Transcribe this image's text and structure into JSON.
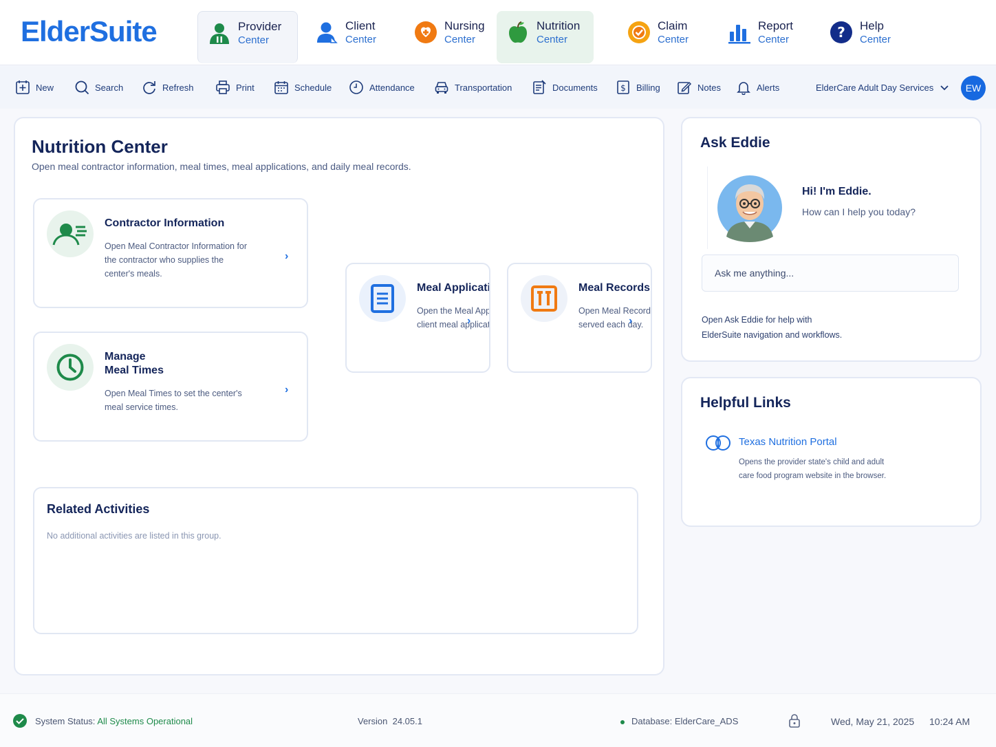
{
  "app": {
    "logo": "ElderSuite"
  },
  "centers": [
    {
      "l1": "Provider",
      "l2": "Center",
      "icon": "provider-icon"
    },
    {
      "l1": "Client",
      "l2": "Center",
      "icon": "client-icon"
    },
    {
      "l1": "Nursing",
      "l2": "Center",
      "icon": "nursing-icon"
    },
    {
      "l1": "Nutrition",
      "l2": "Center",
      "icon": "apple-icon"
    },
    {
      "l1": "Claim",
      "l2": "Center",
      "icon": "claim-icon"
    },
    {
      "l1": "Report",
      "l2": "Center",
      "icon": "bar-chart-icon"
    },
    {
      "l1": "Help",
      "l2": "Center",
      "icon": "help-icon"
    }
  ],
  "toolbar": {
    "items": [
      "New",
      "Search",
      "Refresh",
      "Print",
      "Schedule",
      "Attendance",
      "Transportation",
      "Documents",
      "Billing",
      "Notes",
      "Alerts"
    ],
    "org": "ElderCare Adult Day Services",
    "user_initials": "EW"
  },
  "main": {
    "title": "Nutrition Center",
    "subtitle": "Open meal contractor information, meal times, meal applications, and daily meal records.",
    "cards": {
      "contractor": {
        "title": "Contractor Information",
        "desc": [
          "Open Meal Contractor Information for",
          "the contractor who supplies the",
          "center's meals."
        ]
      },
      "mealtimes": {
        "title1": "Manage",
        "title2": "Meal Times",
        "desc": [
          "Open Meal Times to set the center's",
          "meal service times."
        ]
      },
      "applications": {
        "title": "Meal Applications",
        "desc": [
          "Open the Meal Applications",
          "client meal applications"
        ]
      },
      "records": {
        "title": "Meal Records",
        "desc": [
          "Open Meal Records to record",
          "served each day."
        ]
      }
    },
    "related": {
      "title": "Related Activities",
      "empty": "No additional activities are listed in this group."
    }
  },
  "eddie": {
    "title": "Ask Eddie",
    "greeting": "Hi! I'm Eddie.",
    "prompt": "How can I help you today?",
    "placeholder": "Ask me anything...",
    "help": [
      "Open Ask Eddie for help with",
      "ElderSuite navigation and workflows."
    ]
  },
  "links": {
    "title": "Helpful Links",
    "items": [
      {
        "label": "Texas Nutrition Portal",
        "desc": [
          "Opens the provider state's child and adult",
          "care food program website in the browser."
        ]
      }
    ]
  },
  "status": {
    "label": "System Status:",
    "value": "All Systems Operational",
    "version_label": "Version",
    "version": "24.05.1",
    "database": "Database: ElderCare_ADS",
    "date": "Wed, May 21, 2025",
    "time": "10:24 AM"
  },
  "colors": {
    "accent": "#1f6fe0",
    "navy": "#14255a",
    "green": "#1a8a4a",
    "orange": "#f07a12"
  }
}
